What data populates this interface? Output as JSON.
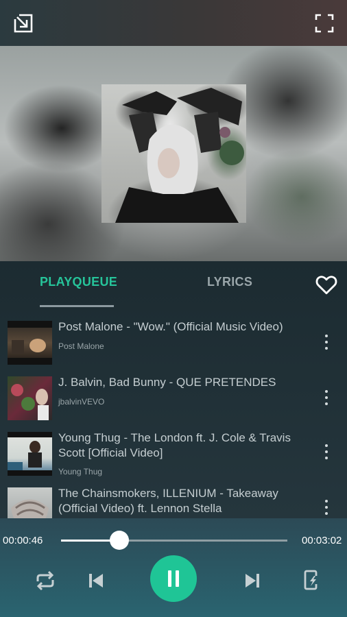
{
  "topbar": {
    "minimize_icon": "minimize-arrow-icon",
    "fullscreen_icon": "fullscreen-icon"
  },
  "tabs": {
    "playqueue": "PLAYQUEUE",
    "lyrics": "LYRICS",
    "favorite_icon": "heart-outline-icon"
  },
  "queue": [
    {
      "title": "Post Malone - \"Wow.\" (Official Music Video)",
      "artist": "Post Malone"
    },
    {
      "title": "J. Balvin, Bad Bunny - QUE PRETENDES",
      "artist": "jbalvinVEVO"
    },
    {
      "title": "Young Thug - The London ft. J. Cole & Travis Scott [Official Video]",
      "artist": "Young Thug"
    },
    {
      "title": "The Chainsmokers, ILLENIUM - Takeaway (Official Video) ft. Lennon Stella",
      "artist": ""
    }
  ],
  "player": {
    "elapsed": "00:00:46",
    "duration": "00:03:02",
    "progress": 0.257,
    "controls": [
      "repeat-icon",
      "previous-icon",
      "pause-icon",
      "next-icon",
      "sleep-timer-icon"
    ]
  },
  "colors": {
    "accent": "#1fc596",
    "tab_active": "#26c49a"
  }
}
